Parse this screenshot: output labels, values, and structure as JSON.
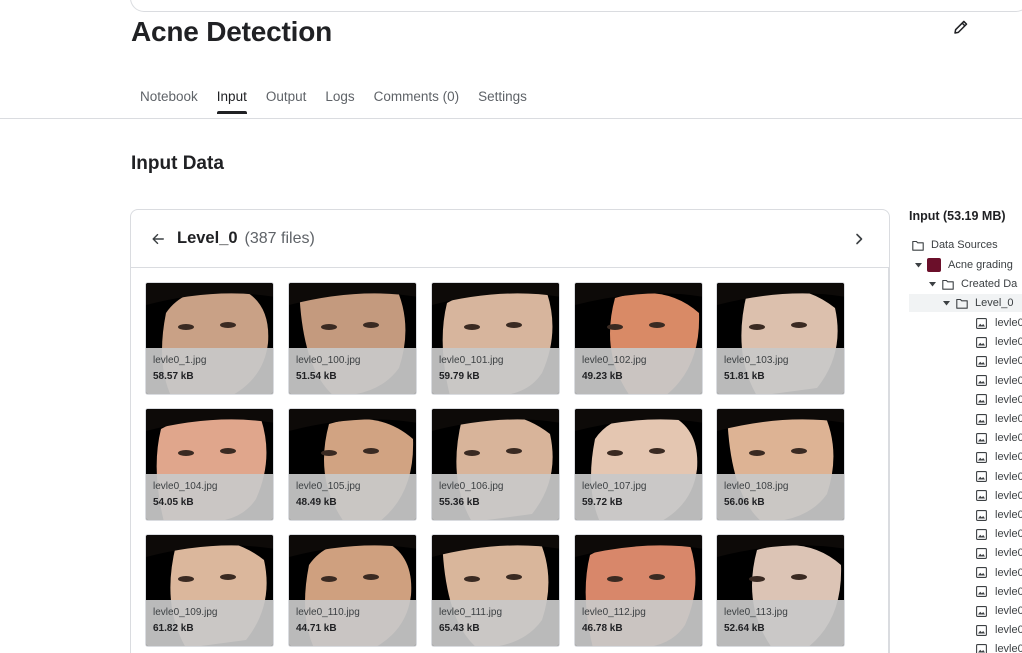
{
  "page": {
    "title": "Acne Detection"
  },
  "tabs": [
    {
      "label": "Notebook",
      "active": false
    },
    {
      "label": "Input",
      "active": true
    },
    {
      "label": "Output",
      "active": false
    },
    {
      "label": "Logs",
      "active": false
    },
    {
      "label": "Comments (0)",
      "active": false
    },
    {
      "label": "Settings",
      "active": false
    }
  ],
  "section": {
    "title": "Input Data"
  },
  "browser": {
    "folder": "Level_0",
    "count": "(387 files)",
    "files": [
      {
        "name": "levle0_1.jpg",
        "size": "58.57 kB",
        "skin": "#c9a186"
      },
      {
        "name": "levle0_100.jpg",
        "size": "51.54 kB",
        "skin": "#c49a7e"
      },
      {
        "name": "levle0_101.jpg",
        "size": "59.79 kB",
        "skin": "#d7b59d"
      },
      {
        "name": "levle0_102.jpg",
        "size": "49.23 kB",
        "skin": "#d98a66"
      },
      {
        "name": "levle0_103.jpg",
        "size": "51.81 kB",
        "skin": "#dcc0ad"
      },
      {
        "name": "levle0_104.jpg",
        "size": "54.05 kB",
        "skin": "#e0a68c"
      },
      {
        "name": "levle0_105.jpg",
        "size": "48.49 kB",
        "skin": "#d1a382"
      },
      {
        "name": "levle0_106.jpg",
        "size": "55.36 kB",
        "skin": "#d8b49a"
      },
      {
        "name": "levle0_107.jpg",
        "size": "59.72 kB",
        "skin": "#e4c6b1"
      },
      {
        "name": "levle0_108.jpg",
        "size": "56.06 kB",
        "skin": "#ddb394"
      },
      {
        "name": "levle0_109.jpg",
        "size": "61.82 kB",
        "skin": "#dbb79c"
      },
      {
        "name": "levle0_110.jpg",
        "size": "44.71 kB",
        "skin": "#cfa07f"
      },
      {
        "name": "levle0_111.jpg",
        "size": "65.43 kB",
        "skin": "#d9b69b"
      },
      {
        "name": "levle0_112.jpg",
        "size": "46.78 kB",
        "skin": "#d8876a"
      },
      {
        "name": "levle0_113.jpg",
        "size": "52.64 kB",
        "skin": "#dcc4b5"
      }
    ]
  },
  "sidebar": {
    "title": "Input (53.19 MB)",
    "data_sources": "Data Sources",
    "dataset": "Acne grading",
    "created": "Created Da",
    "level": "Level_0",
    "file_stub": "levle0",
    "dataset_color": "#6b0f2a"
  }
}
